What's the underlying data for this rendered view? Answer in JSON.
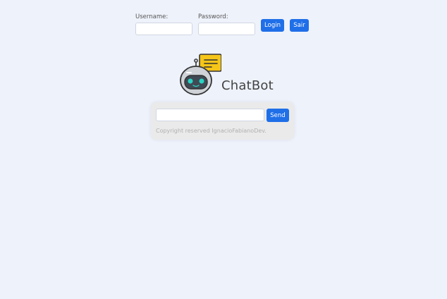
{
  "login": {
    "username_label": "Username:",
    "username_value": "",
    "password_label": "Password:",
    "password_value": "",
    "login_button": "Login",
    "logout_button": "Sair"
  },
  "brand": {
    "logo_icon": "robot-chat-icon",
    "title": "ChatBot"
  },
  "chat": {
    "message_value": "",
    "send_button": "Send",
    "copyright": "Copyright reserved IgnacioFabianoDev."
  },
  "colors": {
    "accent": "#1f6fe8",
    "background": "#eef2fb",
    "panel": "#eaeaea",
    "logo_bubble": "#f5c518"
  }
}
